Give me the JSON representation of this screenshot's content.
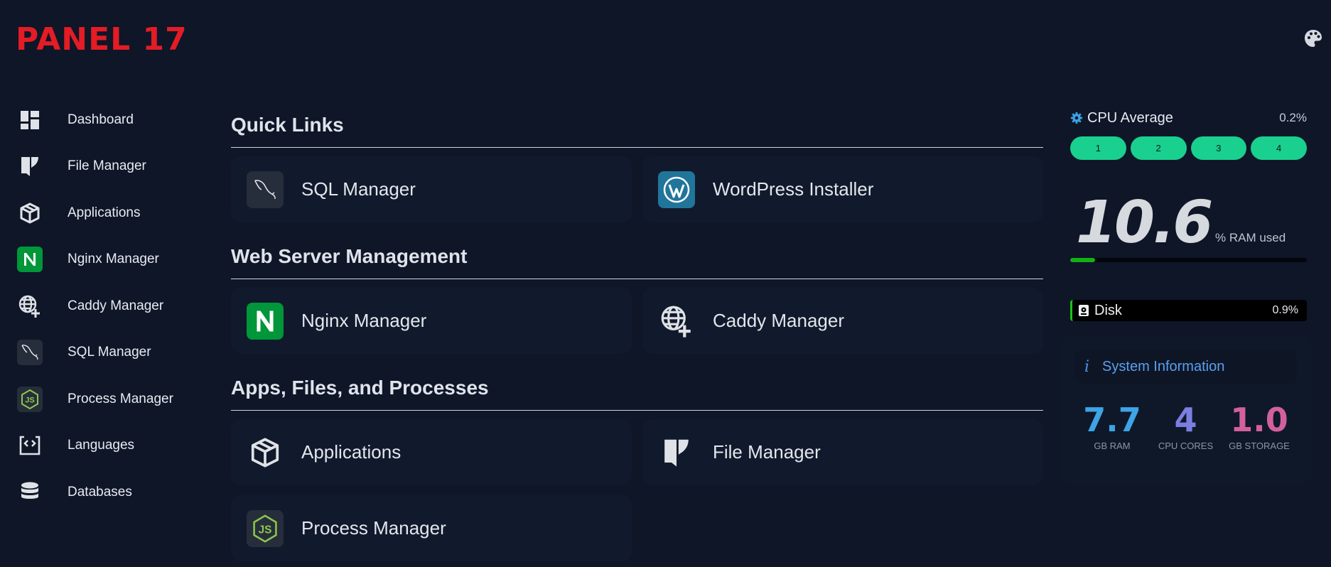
{
  "app": {
    "title": "PANEL 17"
  },
  "header": {
    "palette_icon": "palette-icon"
  },
  "sidebar": {
    "items": [
      {
        "label": "Dashboard",
        "icon": "dashboard-icon"
      },
      {
        "label": "File Manager",
        "icon": "file-manager-icon"
      },
      {
        "label": "Applications",
        "icon": "package-icon"
      },
      {
        "label": "Nginx Manager",
        "icon": "nginx-icon"
      },
      {
        "label": "Caddy Manager",
        "icon": "globe-plus-icon"
      },
      {
        "label": "SQL Manager",
        "icon": "mysql-dolphin-icon"
      },
      {
        "label": "Process Manager",
        "icon": "nodejs-icon"
      },
      {
        "label": "Languages",
        "icon": "code-file-icon"
      },
      {
        "label": "Databases",
        "icon": "database-icon"
      }
    ]
  },
  "main": {
    "sections": [
      {
        "title": "Quick Links",
        "cards": [
          {
            "label": "SQL Manager",
            "icon": "mysql-dolphin-icon"
          },
          {
            "label": "WordPress Installer",
            "icon": "wordpress-icon"
          }
        ]
      },
      {
        "title": "Web Server Management",
        "cards": [
          {
            "label": "Nginx Manager",
            "icon": "nginx-icon"
          },
          {
            "label": "Caddy Manager",
            "icon": "globe-plus-icon"
          }
        ]
      },
      {
        "title": "Apps, Files, and Processes",
        "cards": [
          {
            "label": "Applications",
            "icon": "package-icon"
          },
          {
            "label": "File Manager",
            "icon": "file-manager-icon"
          },
          {
            "label": "Process Manager",
            "icon": "nodejs-icon"
          }
        ]
      }
    ]
  },
  "stats": {
    "cpu": {
      "title": "CPU Average",
      "value": "0.2%",
      "cores": [
        "1",
        "2",
        "3",
        "4"
      ],
      "core_color": "#19d08f"
    },
    "ram": {
      "value": "10.6",
      "unit": "% RAM used",
      "percent": 10.6,
      "bar_color": "#14b014"
    },
    "disk": {
      "title": "Disk",
      "value": "0.9%"
    },
    "system_info": {
      "title": "System Information",
      "info_glyph": "i",
      "items": [
        {
          "value": "7.7",
          "label": "GB RAM",
          "color": "#3da4e6"
        },
        {
          "value": "4",
          "label": "CPU CORES",
          "color": "#7b7fe0"
        },
        {
          "value": "1.0",
          "label": "GB STORAGE",
          "color": "#d2609f"
        }
      ]
    }
  },
  "colors": {
    "background": "#0e1628",
    "card": "#111a2c",
    "brand_red": "#e31c25",
    "nginx_green": "#009639",
    "wordpress_blue": "#21759b",
    "node_green": "#8cc84b"
  }
}
